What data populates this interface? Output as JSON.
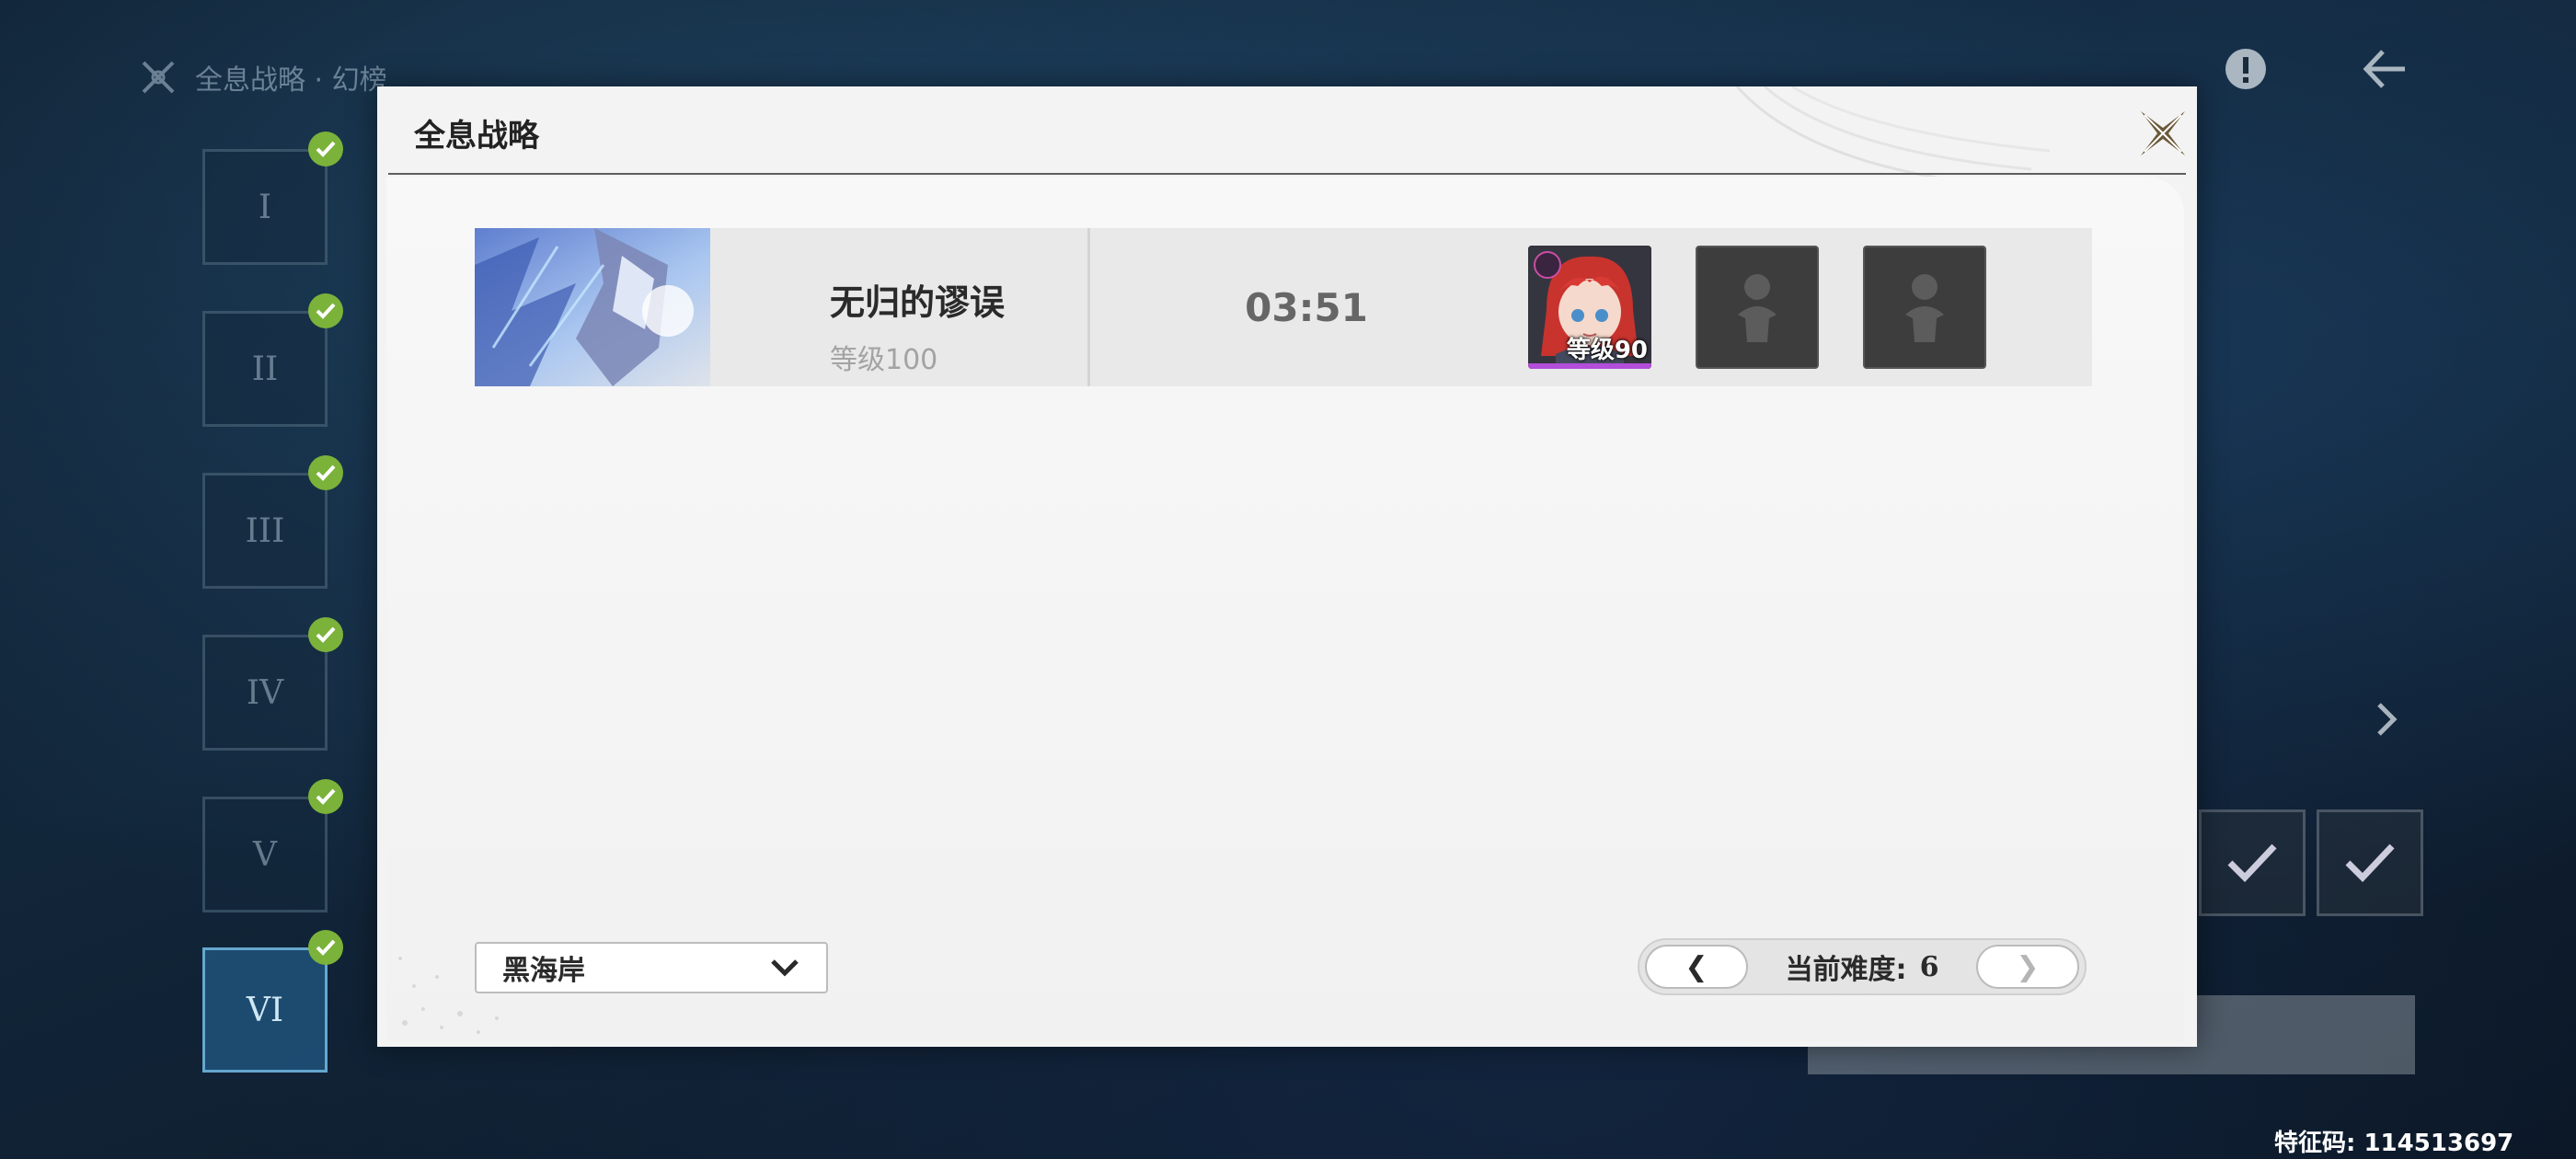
{
  "background": {
    "title": "全息战略 · 幻榜",
    "stages": [
      "I",
      "II",
      "III",
      "IV",
      "V",
      "VI"
    ],
    "active_stage": "VI",
    "feature_code": "特征码: 114513697"
  },
  "modal": {
    "title": "全息战略",
    "record": {
      "boss_name": "无归的谬误",
      "boss_level": "等级100",
      "clear_time": "03:51",
      "team": [
        {
          "type": "character",
          "level": "等级90",
          "element_color": "#c94ea3"
        },
        {
          "type": "empty"
        },
        {
          "type": "empty"
        }
      ]
    },
    "region_dropdown": {
      "selected": "黑海岸"
    },
    "difficulty": {
      "label": "当前难度:",
      "value": "6",
      "prev_label": "❮",
      "next_label": "❯"
    }
  },
  "colors": {
    "modal_bg": "#f3f3f3",
    "record_bg": "#e9e9e9",
    "check_green": "#7bb23a",
    "level_bar": "#b24ed9"
  }
}
